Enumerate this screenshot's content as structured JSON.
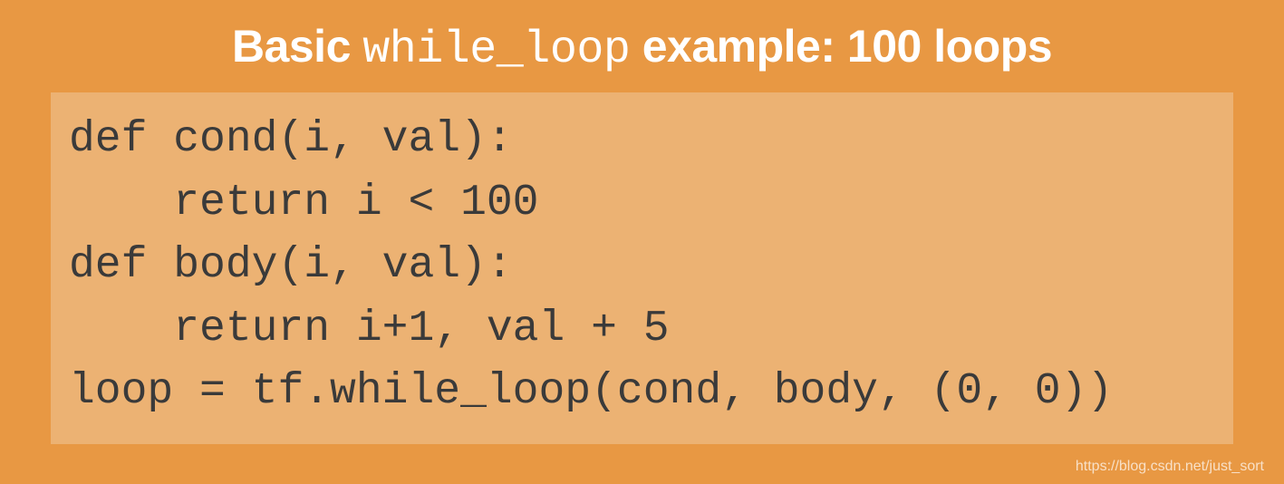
{
  "title": {
    "part1": "Basic ",
    "code": "while_loop",
    "part2": " example: 100 loops"
  },
  "code": {
    "line1": "def cond(i, val):",
    "line2": "    return i < 100",
    "line3": "def body(i, val):",
    "line4": "    return i+1, val + 5",
    "line5": "loop = tf.while_loop(cond, body, (0, 0))"
  },
  "watermark": "https://blog.csdn.net/just_sort"
}
